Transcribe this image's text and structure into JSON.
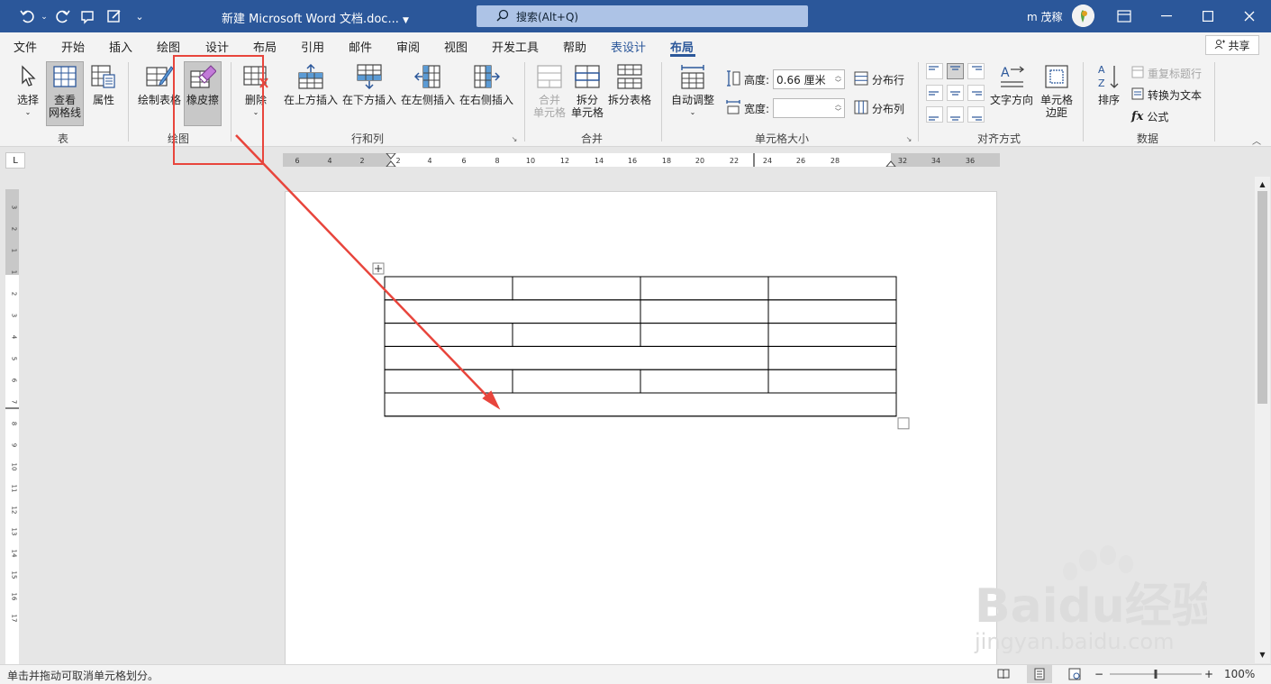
{
  "titlebar": {
    "title": "新建 Microsoft Word 文档.doc...",
    "search_placeholder": "搜索(Alt+Q)",
    "user_name": "m 茂稼",
    "bg_color": "#2b579a"
  },
  "tabs": {
    "items": [
      "文件",
      "开始",
      "插入",
      "绘图",
      "设计",
      "布局",
      "引用",
      "邮件",
      "审阅",
      "视图",
      "开发工具",
      "帮助",
      "表设计",
      "布局"
    ],
    "share_label": "共享"
  },
  "ribbon": {
    "select_label": "选择",
    "view_gridlines_label": "查看\n网格线",
    "properties_label": "属性",
    "group_table": "表",
    "draw_table_label": "绘制表格",
    "eraser_label": "橡皮擦",
    "group_draw": "绘图",
    "delete_label": "删除",
    "insert_above_label": "在上方插入",
    "insert_below_label": "在下方插入",
    "insert_left_label": "在左侧插入",
    "insert_right_label": "在右侧插入",
    "group_rows_cols": "行和列",
    "merge_cells_label": "合并\n单元格",
    "split_cells_label": "拆分\n单元格",
    "split_table_label": "拆分表格",
    "group_merge": "合并",
    "autofit_label": "自动调整",
    "height_label": "高度:",
    "height_value": "0.66 厘米",
    "width_label": "宽度:",
    "width_value": "",
    "distribute_rows_label": "分布行",
    "distribute_cols_label": "分布列",
    "group_cell_size": "单元格大小",
    "text_direction_label": "文字方向",
    "cell_margins_label": "单元格\n边距",
    "group_alignment": "对齐方式",
    "sort_label": "排序",
    "repeat_header_label": "重复标题行",
    "convert_text_label": "转换为文本",
    "formula_label": "公式",
    "group_data": "数据"
  },
  "ruler": {
    "h_ticks": [
      "6",
      "4",
      "2",
      "2",
      "4",
      "6",
      "8",
      "10",
      "12",
      "14",
      "16",
      "18",
      "20",
      "22",
      "24",
      "26",
      "28",
      "32",
      "34",
      "36"
    ],
    "v_ticks": [
      "3",
      "2",
      "1",
      "1",
      "2",
      "3",
      "4",
      "5",
      "6",
      "7",
      "8",
      "9",
      "10",
      "11",
      "12",
      "13",
      "14",
      "15",
      "16",
      "17"
    ]
  },
  "table": {
    "rows": [
      [
        1,
        1,
        1,
        1
      ],
      [
        2,
        1,
        1
      ],
      [
        1,
        1,
        1,
        1
      ],
      [
        3,
        1
      ],
      [
        1,
        1,
        1,
        1
      ],
      [
        4
      ]
    ]
  },
  "annotation": {
    "color": "#e8453c"
  },
  "statusbar": {
    "message": "单击并拖动可取消单元格划分。",
    "zoom": "100%",
    "zoom_fraction": 0.5
  },
  "watermark": {
    "brand": "Baidu经验",
    "url": "jingyan.baidu.com"
  }
}
